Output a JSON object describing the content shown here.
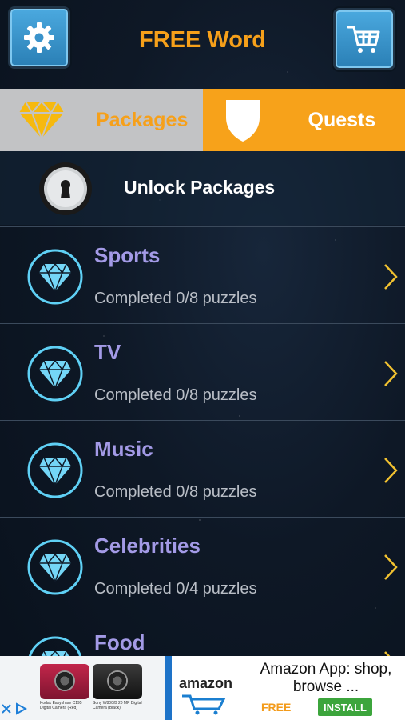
{
  "header": {
    "title": "FREE Word",
    "settings_icon": "gear-icon",
    "cart_icon": "shopping-cart-icon"
  },
  "tabs": [
    {
      "label": "Packages",
      "icon": "diamond-icon",
      "selected": false
    },
    {
      "label": "Quests",
      "icon": "shield-icon",
      "selected": true
    }
  ],
  "unlock": {
    "label": "Unlock Packages",
    "icon": "keyhole-lock-icon"
  },
  "packages": [
    {
      "title": "Sports",
      "status": "Completed 0/8 puzzles"
    },
    {
      "title": "TV",
      "status": "Completed 0/8 puzzles"
    },
    {
      "title": "Music",
      "status": "Completed 0/8 puzzles"
    },
    {
      "title": "Celebrities",
      "status": "Completed 0/4 puzzles"
    },
    {
      "title": "Food",
      "status": ""
    }
  ],
  "ad": {
    "product1_caption": "Kodak Easyshare C195 Digital Camera (Red)",
    "product2_caption": "Sony W800/B 20 MP Digital Camera (Black)",
    "brand": "amazon",
    "title": "Amazon App: shop, browse ...",
    "price": "FREE",
    "install_label": "INSTALL"
  },
  "colors": {
    "accent_orange": "#f7a21a",
    "title_purple": "#a39ae6",
    "icon_cyan": "#5fd0f5",
    "chevron_yellow": "#f2c230"
  }
}
